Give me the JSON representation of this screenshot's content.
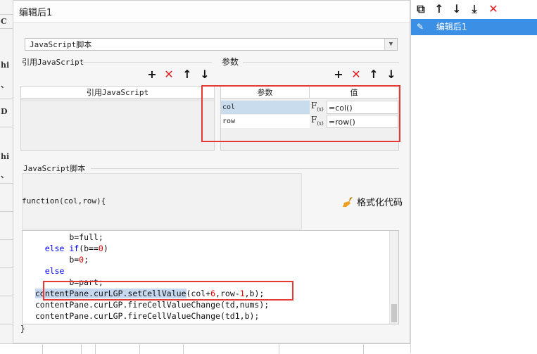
{
  "background": {
    "left_glyphs": [
      "C",
      "hi",
      "、",
      "D",
      "hi",
      "、"
    ]
  },
  "dialog": {
    "title": "编辑后1",
    "type_select": {
      "value": "JavaScript脚本"
    },
    "ref_section": {
      "title": "引用JavaScript",
      "column_header": "引用JavaScript"
    },
    "param_section": {
      "title": "参数",
      "columns": [
        "参数",
        "值"
      ],
      "rows": [
        {
          "name": "col",
          "value": "=col()"
        },
        {
          "name": "row",
          "value": "=row()"
        }
      ]
    },
    "script_section": {
      "title": "JavaScript脚本",
      "signature": "function(col,row){",
      "format_button": "格式化代码",
      "closing": "}"
    },
    "toolbar_icons": [
      "add-icon",
      "delete-icon",
      "move-up-icon",
      "move-down-icon"
    ]
  },
  "code_lines": [
    {
      "indent": "         ",
      "parts": [
        {
          "t": "b=full;"
        }
      ]
    },
    {
      "indent": "    ",
      "parts": [
        {
          "t": "else ",
          "c": "kw"
        },
        {
          "t": "if",
          "c": "kw"
        },
        {
          "t": "(b=="
        },
        {
          "t": "0",
          "c": "num"
        },
        {
          "t": ")"
        }
      ]
    },
    {
      "indent": "         ",
      "parts": [
        {
          "t": "b="
        },
        {
          "t": "0",
          "c": "num"
        },
        {
          "t": ";"
        }
      ]
    },
    {
      "indent": "    ",
      "parts": [
        {
          "t": "else",
          "c": "kw"
        }
      ]
    },
    {
      "indent": "         ",
      "parts": [
        {
          "t": "b=part;"
        }
      ]
    },
    {
      "indent": "  ",
      "parts": [
        {
          "t": "contentPane.curLGP.setCellValue"
        },
        {
          "t": "(col+"
        },
        {
          "t": "6",
          "c": "num"
        },
        {
          "t": ",row-"
        },
        {
          "t": "1",
          "c": "num"
        },
        {
          "t": ",b);"
        }
      ]
    },
    {
      "indent": "  ",
      "parts": [
        {
          "t": "contentPane.curLGP.fireCellValueChange(td,nums);"
        }
      ]
    },
    {
      "indent": "  ",
      "parts": [
        {
          "t": "contentPane.curLGP.fireCellValueChange(td1,b);"
        }
      ]
    }
  ],
  "right_panel": {
    "tools": [
      "copy-icon",
      "move-up-icon",
      "move-down-icon",
      "move-to-bottom-icon",
      "delete-icon"
    ],
    "items": [
      {
        "label": "编辑后1",
        "selected": true
      }
    ]
  },
  "colors": {
    "accent": "#3b8fe5",
    "highlight_box": "#e53935",
    "selected_param_row": "#c9dcee"
  }
}
